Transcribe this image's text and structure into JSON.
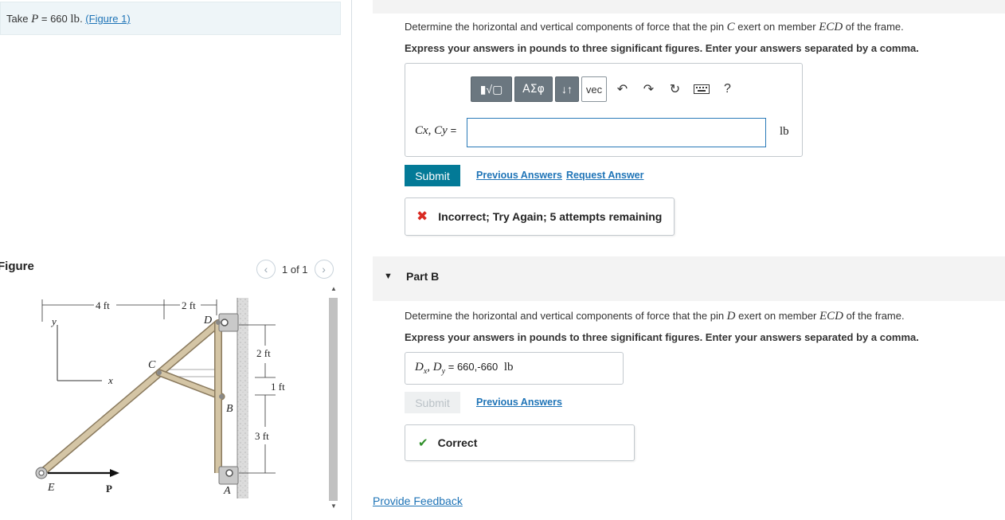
{
  "left": {
    "given_prefix": "Take",
    "given_var": "P",
    "given_eq": " = 660 ",
    "given_unit": "lb",
    "figure_link": "(Figure 1)",
    "figure_title": "Figure",
    "pager_text": "1 of 1",
    "figure_labels": {
      "dim_4ft": "4 ft",
      "dim_2ft_top": "2 ft",
      "dim_2ft": "2 ft",
      "dim_1ft": "1 ft",
      "dim_3ft": "3 ft",
      "y": "y",
      "x": "x",
      "D": "D",
      "C": "C",
      "B": "B",
      "A": "A",
      "E": "E",
      "P": "P"
    }
  },
  "partA": {
    "question_pre": "Determine the horizontal and vertical components of force that the pin ",
    "question_pin": "C",
    "question_mid": " exert on member ",
    "question_member": "ECD",
    "question_post": " of the frame.",
    "instruction": "Express your answers in pounds to three significant figures. Enter your answers separated by a comma.",
    "toolbar": {
      "templates_label": "▮√▢",
      "greek_label": "ΑΣφ",
      "arrows_label": "↓↑",
      "vec_label": "vec",
      "help_label": "?"
    },
    "input_label": "Cx, Cy",
    "input_label_eq": "=",
    "input_value": "",
    "unit": "lb",
    "submit_label": "Submit",
    "previous_answers": "Previous Answers",
    "request_answer": "Request Answer",
    "status": "Incorrect; Try Again; 5 attempts remaining"
  },
  "partB": {
    "title": "Part B",
    "question_pre": "Determine the horizontal and vertical components of force that the pin ",
    "question_pin": "D",
    "question_mid": " exert on member ",
    "question_member": "ECD",
    "question_post": " of the frame.",
    "instruction": "Express your answers in pounds to three significant figures. Enter your answers separated by a comma.",
    "answer_label_eq": "=",
    "answer_value": "660,-660",
    "unit": "lb",
    "submit_label": "Submit",
    "previous_answers": "Previous Answers",
    "status": "Correct"
  },
  "feedback_link": "Provide Feedback",
  "colors": {
    "link": "#1f74b7",
    "submit": "#037a97",
    "incorrect": "#d92a22",
    "correct": "#2f8f2a",
    "member": "#c8b89a"
  }
}
